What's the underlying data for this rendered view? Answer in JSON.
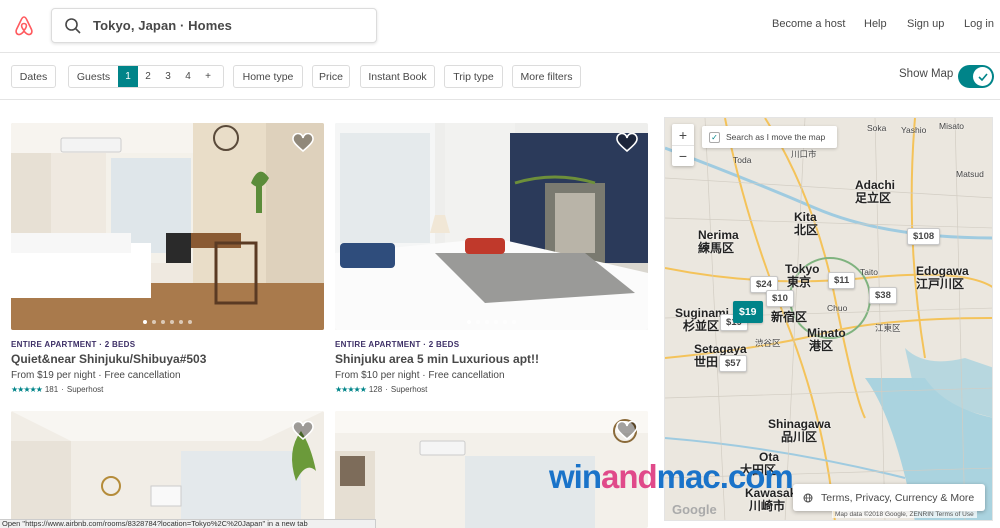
{
  "header": {
    "search_text": "Tokyo, Japan · Homes",
    "nav": [
      "Become a host",
      "Help",
      "Sign up",
      "Log in"
    ]
  },
  "filters": {
    "dates": "Dates",
    "guests_label": "Guests",
    "guest_options": [
      "1",
      "2",
      "3",
      "4",
      "+"
    ],
    "selected_guests": "1",
    "home_type": "Home type",
    "price": "Price",
    "instant_book": "Instant Book",
    "trip_type": "Trip type",
    "more_filters": "More filters",
    "show_map": "Show Map",
    "show_map_on": true
  },
  "listings": [
    {
      "type": "ENTIRE APARTMENT · 2 BEDS",
      "title": "Quiet&near Shinjuku/Shibuya#503",
      "price": "From $19  per night · Free cancellation",
      "rating_count": "181",
      "badge": "Superhost",
      "stars": 5
    },
    {
      "type": "ENTIRE APARTMENT · 2 BEDS",
      "title": "Shinjuku area 5 min Luxurious apt!!",
      "price": "From $10  per night · Free cancellation",
      "rating_count": "128",
      "badge": "Superhost",
      "stars": 5
    },
    {
      "type": "",
      "title": "",
      "price": "",
      "rating_count": "",
      "badge": "",
      "stars": 0
    },
    {
      "type": "",
      "title": "",
      "price": "",
      "rating_count": "",
      "badge": "",
      "stars": 0
    }
  ],
  "map": {
    "search_as_move": "Search as I move the map",
    "zoom_in": "+",
    "zoom_out": "−",
    "pins": [
      "$24",
      "$11",
      "$108",
      "$38",
      "$10",
      "$19",
      "$19",
      "$57"
    ],
    "labels": {
      "adachi": "Adachi",
      "adachi_jp": "足立区",
      "nerima": "Nerima",
      "nerima_jp": "練馬区",
      "kita": "Kita",
      "kita_jp": "北区",
      "tokyo": "Tokyo",
      "tokyo_jp": "東京",
      "taito": "Taito",
      "edogawa": "Edogawa",
      "edogawa_jp": "江戸川区",
      "suginami": "Suginami",
      "suginami_jp": "杉並区",
      "setagaya": "Setagaya",
      "setagaya_jp": "世田",
      "minato": "Minato",
      "minato_jp": "港区",
      "shinjuku_jp": "新宿区",
      "shinagawa": "Shinagawa",
      "shinagawa_jp": "品川区",
      "ota": "Ota",
      "ota_jp": "大田区",
      "kawasaki": "Kawasaki",
      "kawasaki_jp": "川崎市",
      "soka": "Soka",
      "yashio": "Yashio",
      "misato": "Misato",
      "kawaguchi": "川口市",
      "toda": "Toda",
      "matsudo": "Matsud",
      "koto": "江東区",
      "chuo": "Chuo",
      "shibuya": "渋谷区"
    },
    "terms": "Terms, Privacy, Currency & More",
    "map_data": "Map data ©2018 Google, ZENRIN   Terms of Use",
    "google": "Google"
  },
  "statusbar": "Open \"https://www.airbnb.com/rooms/8328784?location=Tokyo%2C%20Japan\" in a new tab",
  "watermark": {
    "p1": "win",
    "p2": "and",
    "p3": "mac.com"
  },
  "colors": {
    "accent": "#008489",
    "brand": "#FF5A5F",
    "type_label": "#3d2f66"
  }
}
